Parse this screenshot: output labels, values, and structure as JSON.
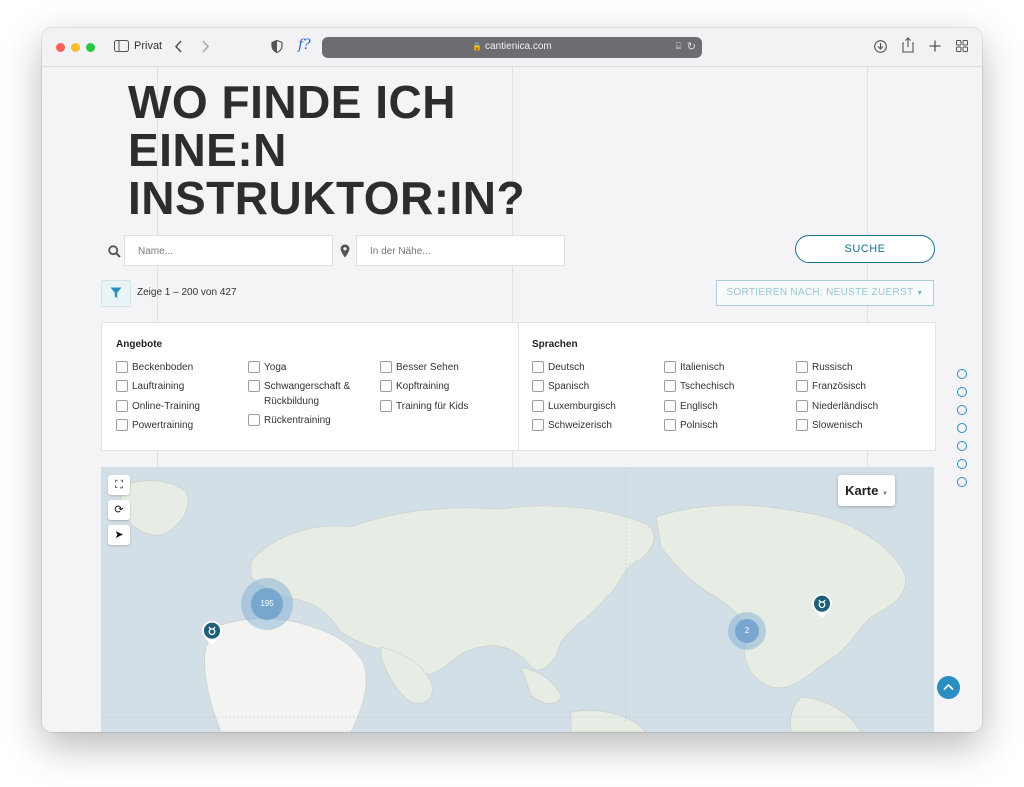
{
  "browser": {
    "private_label": "Privat",
    "url": "cantienica.com",
    "icons": [
      "sidebar-icon",
      "back-icon",
      "forward-icon",
      "shield-icon",
      "font-icon",
      "lock-icon",
      "translate-icon",
      "reload-icon",
      "download-icon",
      "share-icon",
      "new-tab-icon",
      "tabs-overview-icon"
    ]
  },
  "page": {
    "title": "WO FINDE ICH EINE:N INSTRUKTOR:IN?",
    "search": {
      "name_placeholder": "Name...",
      "location_placeholder": "In der Nähe...",
      "button_label": "SUCHE"
    },
    "results_count": "Zeige 1 – 200 von 427",
    "sort_label": "SORTIEREN NACH: NEUSTE ZUERST",
    "filters": {
      "offers": {
        "heading": "Angebote",
        "columns": [
          [
            "Beckenboden",
            "Lauftraining",
            "Online-Training",
            "Powertraining"
          ],
          [
            "Yoga",
            "Schwangerschaft & Rückbildung",
            "Rückentraining"
          ],
          [
            "Besser Sehen",
            "Kopftraining",
            "Training für Kids"
          ]
        ]
      },
      "languages": {
        "heading": "Sprachen",
        "columns": [
          [
            "Deutsch",
            "Spanisch",
            "Luxemburgisch",
            "Schweizerisch"
          ],
          [
            "Italienisch",
            "Tschechisch",
            "Englisch",
            "Polnisch"
          ],
          [
            "Russisch",
            "Französisch",
            "Niederländisch",
            "Slowenisch"
          ]
        ]
      }
    },
    "map": {
      "type_selector": "Karte",
      "clusters": [
        {
          "count": "195"
        },
        {
          "count": "2"
        }
      ]
    }
  },
  "colors": {
    "accent": "#1a6f93",
    "cluster": "#6ea0cd",
    "scroll_button": "#2a8ec1"
  }
}
